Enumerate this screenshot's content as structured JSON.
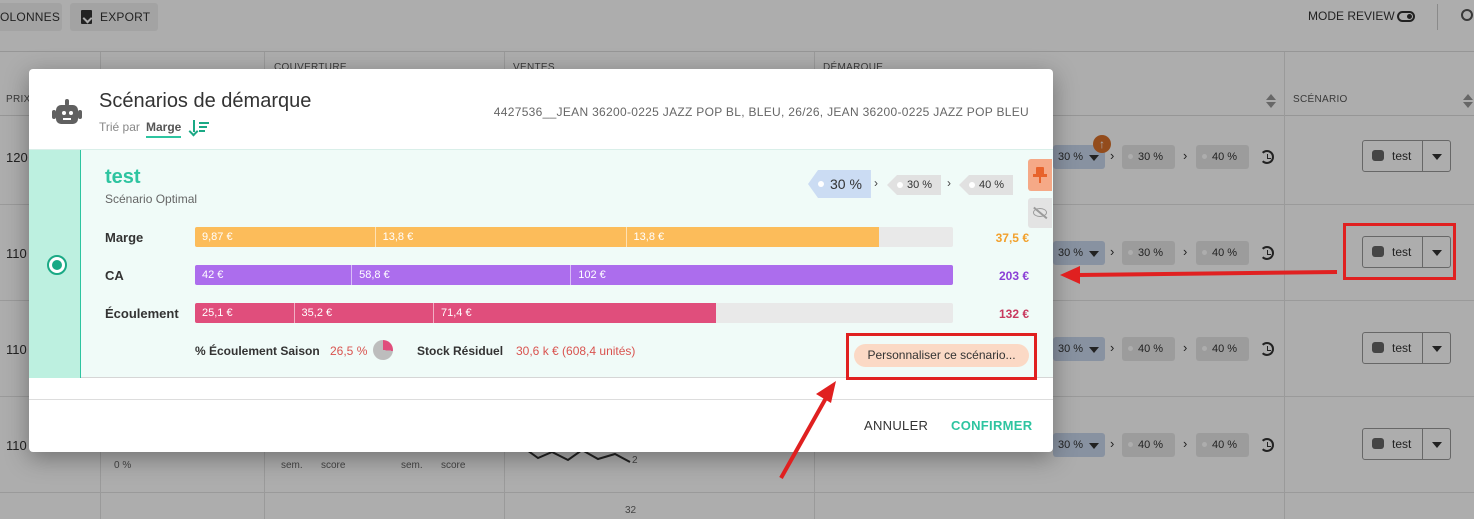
{
  "toolbar": {
    "columns_label": "OLONNES",
    "export_label": "EXPORT",
    "review_label": "MODE REVIEW"
  },
  "table": {
    "headers": {
      "prix": "PRIX",
      "couverture": "COUVERTURE",
      "ventes": "VENTES",
      "demarque": "DÉMARQUE",
      "scenario": "SCÉNARIO"
    },
    "rows": [
      {
        "price": "120",
        "scenario": "test",
        "pills": [
          "30 %",
          "30 %",
          "40 %"
        ]
      },
      {
        "price": "110",
        "scenario": "test",
        "pills": [
          "30 %",
          "30 %",
          "40 %"
        ]
      },
      {
        "price": "110",
        "scenario": "test",
        "pills": [
          "30 %",
          "40 %",
          "40 %"
        ]
      },
      {
        "price": "110",
        "scenario": "test",
        "pills": [
          "30 %",
          "40 %",
          "40 %"
        ]
      }
    ],
    "misc": {
      "pct": "0 %",
      "sem1": "sem.",
      "score1": "score",
      "sem2": "sem.",
      "score2": "score",
      "num_2": "2",
      "num_32": "32"
    }
  },
  "modal": {
    "title": "Scénarios de démarque",
    "sort_label": "Trié par",
    "sort_value": "Marge",
    "product": "4427536__JEAN 36200-0225 JAZZ POP BL, BLEU, 26/26, JEAN 36200-0225 JAZZ POP BLEU",
    "scenario": {
      "name": "test",
      "subtitle": "Scénario Optimal",
      "steps": [
        "30 %",
        "30 %",
        "40 %"
      ],
      "metrics": [
        {
          "label": "Marge",
          "color": "#fcbc5a",
          "total_color": "#f2a02c",
          "fill": 0.903,
          "segments": [
            {
              "label": "9,87 €",
              "width": 0.237
            },
            {
              "label": "13,8 €",
              "width": 0.331
            },
            {
              "label": "13,8 €",
              "width": 0.335
            }
          ],
          "total": "37,5 €"
        },
        {
          "label": "CA",
          "color": "#ac6ded",
          "total_color": "#8a3fd6",
          "fill": 1.0,
          "segments": [
            {
              "label": "42 €",
              "width": 0.206
            },
            {
              "label": "58,8 €",
              "width": 0.289
            },
            {
              "label": "102 €",
              "width": 0.505
            }
          ],
          "total": "203 €"
        },
        {
          "label": "Écoulement",
          "color": "#e04e7c",
          "total_color": "#c8395f",
          "fill": 0.687,
          "segments": [
            {
              "label": "25,1 €",
              "width": 0.13
            },
            {
              "label": "35,2 €",
              "width": 0.184
            },
            {
              "label": "71,4 €",
              "width": 0.373
            }
          ],
          "total": "132 €"
        }
      ],
      "season_label": "% Écoulement Saison",
      "season_value": "26,5 %",
      "season_fraction": 0.265,
      "stock_label": "Stock Résiduel",
      "stock_value": "30,6 k € (608,4 unités)",
      "customize_label": "Personnaliser ce scénario..."
    },
    "cancel_label": "ANNULER",
    "confirm_label": "CONFIRMER"
  },
  "colors": {
    "accent": "#2ec4a0",
    "annotation": "#e02020"
  }
}
